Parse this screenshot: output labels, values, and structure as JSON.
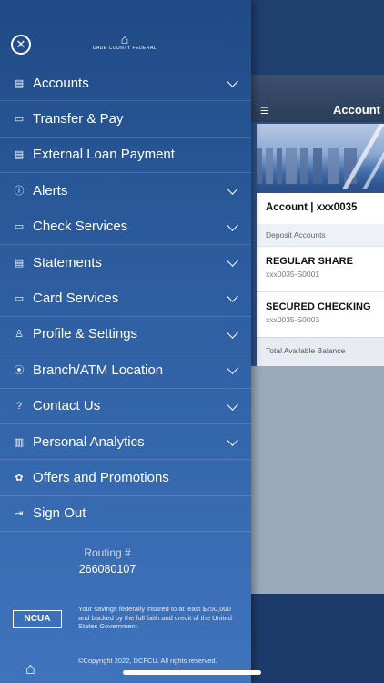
{
  "drawer": {
    "logo_text": "DADE COUNTY FEDERAL",
    "menu": [
      {
        "label": "Accounts",
        "icon": "accounts-icon",
        "glyph": "▤",
        "expandable": true
      },
      {
        "label": "Transfer & Pay",
        "icon": "transfer-icon",
        "glyph": "▭",
        "expandable": false
      },
      {
        "label": "External Loan Payment",
        "icon": "loan-payment-icon",
        "glyph": "▤",
        "expandable": false
      },
      {
        "label": "Alerts",
        "icon": "alert-icon",
        "glyph": "ⓘ",
        "expandable": true
      },
      {
        "label": "Check Services",
        "icon": "check-icon",
        "glyph": "▭",
        "expandable": true
      },
      {
        "label": "Statements",
        "icon": "statement-icon",
        "glyph": "▤",
        "expandable": true
      },
      {
        "label": "Card Services",
        "icon": "card-icon",
        "glyph": "▭",
        "expandable": true
      },
      {
        "label": "Profile & Settings",
        "icon": "profile-icon",
        "glyph": "♙",
        "expandable": true
      },
      {
        "label": "Branch/ATM Location",
        "icon": "location-pin-icon",
        "glyph": "⦿",
        "expandable": true
      },
      {
        "label": "Contact Us",
        "icon": "help-icon",
        "glyph": "?",
        "expandable": true
      },
      {
        "label": "Personal Analytics",
        "icon": "analytics-icon",
        "glyph": "▥",
        "expandable": true
      },
      {
        "label": "Offers and Promotions",
        "icon": "offers-icon",
        "glyph": "✿",
        "expandable": false
      },
      {
        "label": "Sign Out",
        "icon": "sign-out-icon",
        "glyph": "⇥",
        "expandable": false
      }
    ],
    "routing_label": "Routing #",
    "routing_number": "266080107",
    "ncua_label": "NCUA",
    "insurance_text": "Your savings federally insured to at least $250,000 and backed by the full faith and credit of the United States Government.",
    "copyright_text": "©Copyright 2022, DCFCU. All rights reserved."
  },
  "background": {
    "header_title": "Account",
    "account_header": "Account | xxx0035",
    "deposit_label": "Deposit Accounts",
    "accounts": [
      {
        "name": "REGULAR SHARE",
        "number": "xxx0035-S0001"
      },
      {
        "name": "SECURED CHECKING",
        "number": "xxx0035-S0003"
      }
    ],
    "total_label": "Total Available Balance"
  }
}
